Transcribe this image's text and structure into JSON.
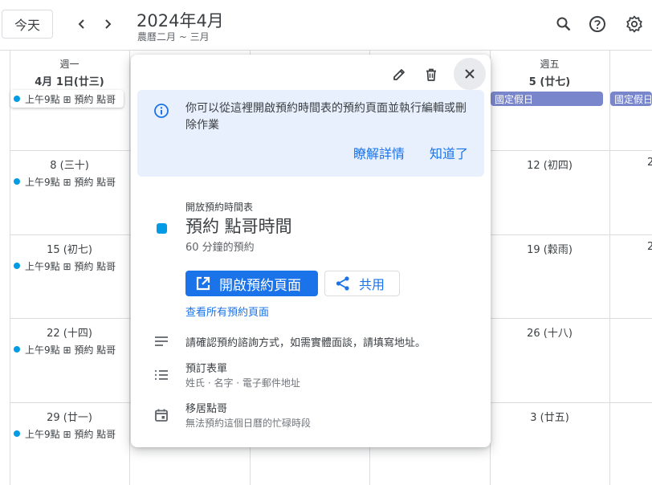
{
  "header": {
    "today_label": "今天",
    "title": "2024年4月",
    "subtitle": "農曆二月 ~ 三月",
    "icons": [
      "chevron-left-icon",
      "chevron-right-icon",
      "search-icon",
      "help-icon",
      "settings-icon"
    ]
  },
  "calendar": {
    "columns": [
      {
        "dow": "週一",
        "date": "4月 1日(廿三)"
      },
      {
        "dow": "週五",
        "date": "5 (廿七)"
      }
    ],
    "week_dates_col1": [
      "8 (三十)",
      "15 (初七)",
      "22 (十四)",
      "29 (廿一)"
    ],
    "week_dates_col5": [
      "12 (初四)",
      "19 (穀雨)",
      "26 (十八)",
      "3 (廿五)"
    ],
    "event_label": "上午9點 ⊞ 預約 點哥",
    "holiday_label": "國定假日",
    "holiday_label_2": "國定假日",
    "edge_dates": [
      "2",
      "2"
    ],
    "colors": {
      "event_dot": "#039be5",
      "holiday": "#7986cb",
      "grid": "#dadce0"
    }
  },
  "popup": {
    "info_text": "你可以從這裡開啟預約時間表的預約頁面並執行編輯或刪除作業",
    "learn_more": "瞭解詳情",
    "got_it": "知道了",
    "schedule_type": "開放預約時間表",
    "title": "預約 點哥時間",
    "duration": "60 分鐘的預約",
    "open_page_label": "開啟預約頁面",
    "share_label": "共用",
    "view_all_link": "查看所有預約頁面",
    "description": "請確認預約諮詢方式，如需實體面談，請填寫地址。",
    "form_label": "預訂表單",
    "form_fields": "姓氏 · 名字 · 電子郵件地址",
    "calendar_name": "移居點哥",
    "calendar_note": "無法預約這個日曆的忙碌時段",
    "accent": "#1a73e8"
  }
}
